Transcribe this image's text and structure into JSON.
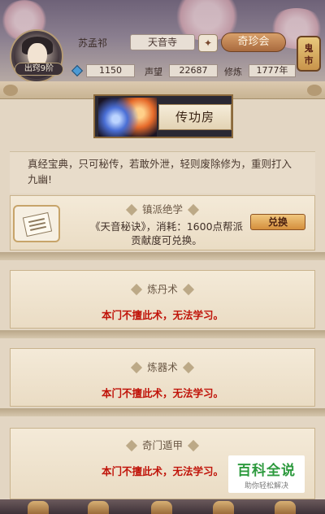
{
  "player": {
    "name": "苏孟祁",
    "rank": "出窍9阶",
    "sect": "天音寺",
    "gems": "1150",
    "reputation_label": "声望",
    "reputation": "22687",
    "cultivation_label": "修炼",
    "cultivation": "1777年"
  },
  "header": {
    "qizhen_label": "奇珍会",
    "ghost_market_label": "鬼市"
  },
  "banner": {
    "label": "传功房"
  },
  "intro": "真经宝典，只可秘传，若敢外泄，轻则废除修为，重则打入九幽!",
  "sections": [
    {
      "title": "镇派绝学",
      "text": "《天音秘诀》，消耗：1600点帮派贡献度可兑换。",
      "button": "兑换"
    },
    {
      "title": "炼丹术",
      "message": "本门不擅此术，无法学习。"
    },
    {
      "title": "炼器术",
      "message": "本门不擅此术，无法学习。"
    },
    {
      "title": "奇门遁甲",
      "message": "本门不擅此术，无法学习。"
    }
  ],
  "watermark": {
    "title": "百科全说",
    "subtitle": "助你轻松解决"
  },
  "colors": {
    "lock_text": "#c0140a",
    "accent_orange": "#d48f3d"
  }
}
